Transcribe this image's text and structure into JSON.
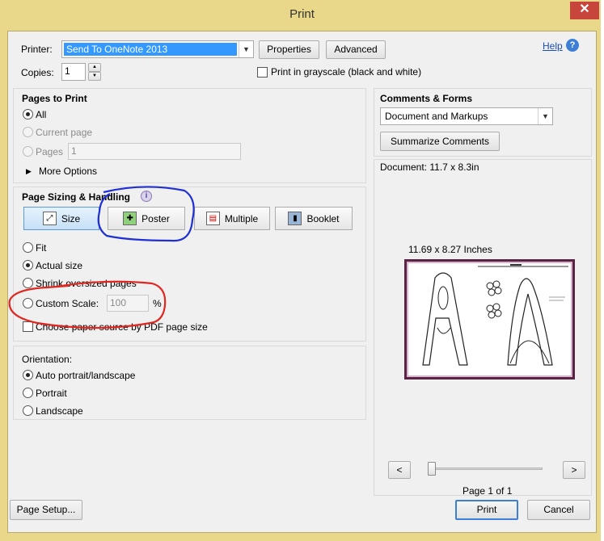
{
  "window": {
    "title": "Print",
    "close_glyph": "✕"
  },
  "printer": {
    "label": "Printer:",
    "value": "Send To OneNote 2013",
    "properties_label": "Properties",
    "advanced_label": "Advanced",
    "help_label": "Help"
  },
  "copies": {
    "label": "Copies:",
    "value": "1",
    "grayscale_label": "Print in grayscale (black and white)",
    "grayscale_checked": false
  },
  "pages_to_print": {
    "heading": "Pages to Print",
    "all_label": "All",
    "current_page_label": "Current page",
    "pages_label": "Pages",
    "pages_value": "1",
    "more_options_label": "More Options"
  },
  "page_sizing": {
    "heading": "Page Sizing & Handling",
    "tabs": [
      {
        "label": "Size",
        "active": true
      },
      {
        "label": "Poster",
        "active": false
      },
      {
        "label": "Multiple",
        "active": false
      },
      {
        "label": "Booklet",
        "active": false
      }
    ],
    "fit_label": "Fit",
    "actual_size_label": "Actual size",
    "shrink_label": "Shrink oversized pages",
    "custom_scale_label": "Custom Scale:",
    "custom_scale_value": "100",
    "percent_symbol": "%",
    "paper_source_label": "Choose paper source by PDF page size"
  },
  "orientation": {
    "heading": "Orientation:",
    "auto_label": "Auto portrait/landscape",
    "portrait_label": "Portrait",
    "landscape_label": "Landscape"
  },
  "comments": {
    "heading": "Comments & Forms",
    "value": "Document and Markups",
    "summarize_label": "Summarize Comments"
  },
  "preview": {
    "document_size": "Document: 11.7 x 8.3in",
    "paper_size": "11.69 x 8.27 Inches",
    "prev_glyph": "<",
    "next_glyph": ">",
    "page_indicator": "Page 1 of 1"
  },
  "footer": {
    "page_setup_label": "Page Setup...",
    "print_label": "Print",
    "cancel_label": "Cancel"
  },
  "colors": {
    "annotation_blue": "#1f2fd6",
    "annotation_red": "#e0261f",
    "preview_border": "#5a2346"
  }
}
